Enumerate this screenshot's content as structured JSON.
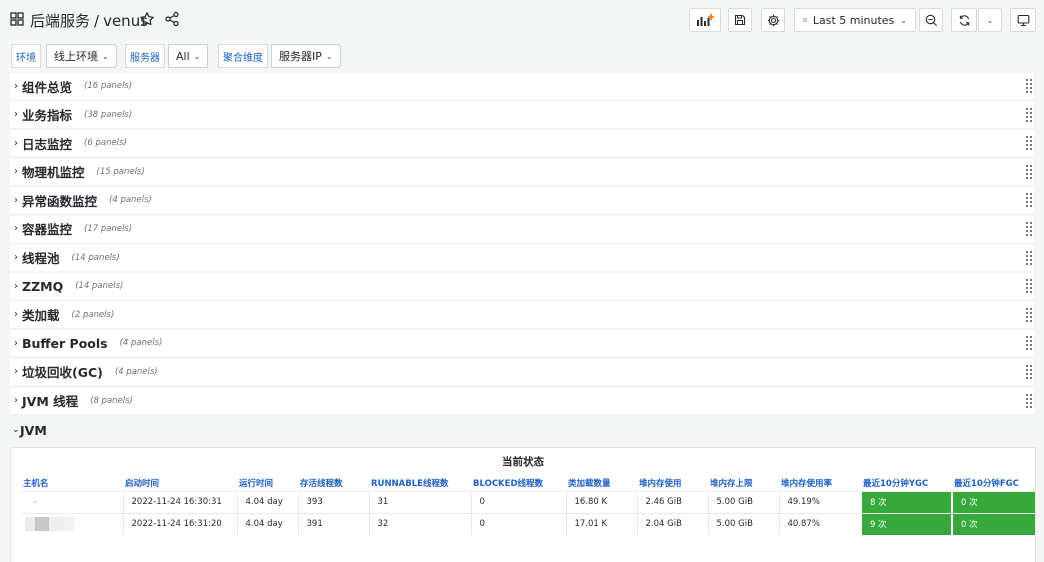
{
  "header": {
    "folder": "后端服务",
    "separator": "/",
    "dashboard": "venus"
  },
  "toolbar": {
    "time_range": "Last 5 minutes"
  },
  "variables": [
    {
      "label": "环境",
      "value": "线上环境"
    },
    {
      "label": "服务器",
      "value": "All"
    },
    {
      "label": "聚合维度",
      "value": "服务器IP"
    }
  ],
  "rows": [
    {
      "title": "组件总览",
      "count": "(16 panels)"
    },
    {
      "title": "业务指标",
      "count": "(38 panels)"
    },
    {
      "title": "日志监控",
      "count": "(6 panels)"
    },
    {
      "title": "物理机监控",
      "count": "(15 panels)"
    },
    {
      "title": "异常函数监控",
      "count": "(4 panels)"
    },
    {
      "title": "容器监控",
      "count": "(17 panels)"
    },
    {
      "title": "线程池",
      "count": "(14 panels)"
    },
    {
      "title": "ZZMQ",
      "count": "(14 panels)"
    },
    {
      "title": "类加载",
      "count": "(2 panels)"
    },
    {
      "title": "Buffer Pools",
      "count": "(4 panels)"
    },
    {
      "title": "垃圾回收(GC)",
      "count": "(4 panels)"
    },
    {
      "title": "JVM 线程",
      "count": "(8 panels)"
    }
  ],
  "expanded_row": {
    "title": "JVM"
  },
  "panel": {
    "title": "当前状态",
    "columns": [
      "主机名",
      "启动时间",
      "运行时间",
      "存活线程数",
      "RUNNABLE线程数",
      "BLOCKED线程数",
      "类加载数量",
      "堆内存使用",
      "堆内存上限",
      "堆内存使用率",
      "最近10分钟YGC",
      "最近10分钟FGC"
    ],
    "table_rows": [
      [
        "",
        "2022-11-24 16:30:31",
        "4.04 day",
        "393",
        "31",
        "0",
        "16.80 K",
        "2.46 GiB",
        "5.00 GiB",
        "49.19%",
        "8 次",
        "0 次"
      ],
      [
        "",
        "2022-11-24 16:31:20",
        "4.04 day",
        "391",
        "32",
        "0",
        "17.01 K",
        "2.04 GiB",
        "5.00 GiB",
        "40.87%",
        "9 次",
        "0 次"
      ]
    ]
  },
  "colors": {
    "accent_blue": "#1f60c4",
    "status_green": "#37a83c",
    "add_panel_orange": "#ff780a"
  }
}
